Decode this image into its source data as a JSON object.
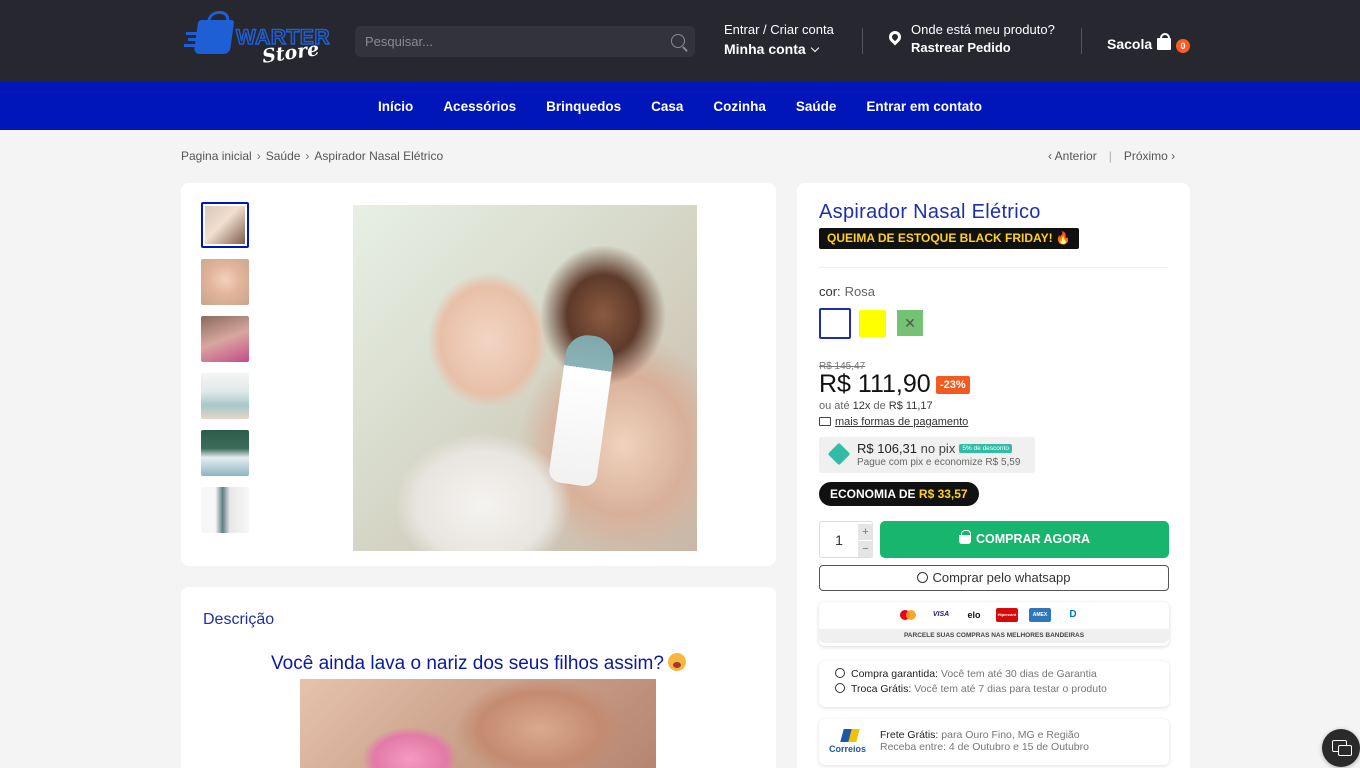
{
  "header": {
    "logo_text_1": "WARTER",
    "logo_text_2": "Store",
    "search_placeholder": "Pesquisar...",
    "account_line1": "Entrar / Criar conta",
    "account_line2": "Minha conta",
    "track_line1": "Onde está meu produto?",
    "track_line2": "Rastrear Pedido",
    "cart_label": "Sacola",
    "cart_count": "0"
  },
  "nav": {
    "items": [
      "Início",
      "Acessórios",
      "Brinquedos",
      "Casa",
      "Cozinha",
      "Saúde",
      "Entrar em contato"
    ]
  },
  "breadcrumb": {
    "items": [
      "Pagina inicial",
      "Saúde",
      "Aspirador Nasal Elétrico"
    ],
    "sep": "›",
    "prev": "‹  Anterior",
    "bar": "|",
    "next": "Próximo  ›"
  },
  "product": {
    "title": "Aspirador Nasal Elétrico",
    "promo": "QUEIMA DE ESTOQUE BLACK FRIDAY! 🔥",
    "color_label": "cor:",
    "color_value": "Rosa",
    "swatch_unavailable_mark": "✕",
    "old_price": "R$ 145,47",
    "price": "R$ 111,90",
    "discount": "-23%",
    "installments_prefix": "ou até",
    "installments_count": "12x",
    "installments_mid": "de",
    "installments_value": "R$ 11,17",
    "more_payment": "mais formas de pagamento",
    "pix_value": "R$ 106,31",
    "pix_suffix": "no pix",
    "pix_tag": "5% de desconto",
    "pix_note": "Pague com pix e economize R$ 5,59",
    "economy_label": "ECONOMIA DE",
    "economy_value": "R$ 33,57",
    "qty": "1",
    "qty_plus": "+",
    "qty_minus": "−",
    "buy_label": "COMPRAR AGORA",
    "whatsapp_label": "Comprar pelo whatsapp",
    "brands": [
      "VISA",
      "elo",
      "Hipercard",
      "AMEX",
      "D"
    ],
    "brands_note": "PARCELE SUAS COMPRAS NAS MELHORES BANDEIRAS",
    "guarantee_title": "Compra garantida:",
    "guarantee_text": "Você tem até 30 dias de Garantia",
    "exchange_title": "Troca Grátis:",
    "exchange_text": "Você tem até 7 dias para testar o produto",
    "shipping_logo": "Correios",
    "shipping_title": "Frete Grátis:",
    "shipping_text": "para Ouro Fino, MG e Região",
    "shipping_dates": "Receba entre: 4 de Outubro e 15 de Outubro"
  },
  "description": {
    "heading": "Descrição",
    "question": "Você ainda lava o nariz dos seus filhos assim?"
  },
  "colors": {
    "nav_bg": "#0016b8",
    "topbar_bg": "#272730",
    "buy_button": "#18b56f",
    "title": "#1f2fa8",
    "discount_badge": "#f25a1f"
  }
}
